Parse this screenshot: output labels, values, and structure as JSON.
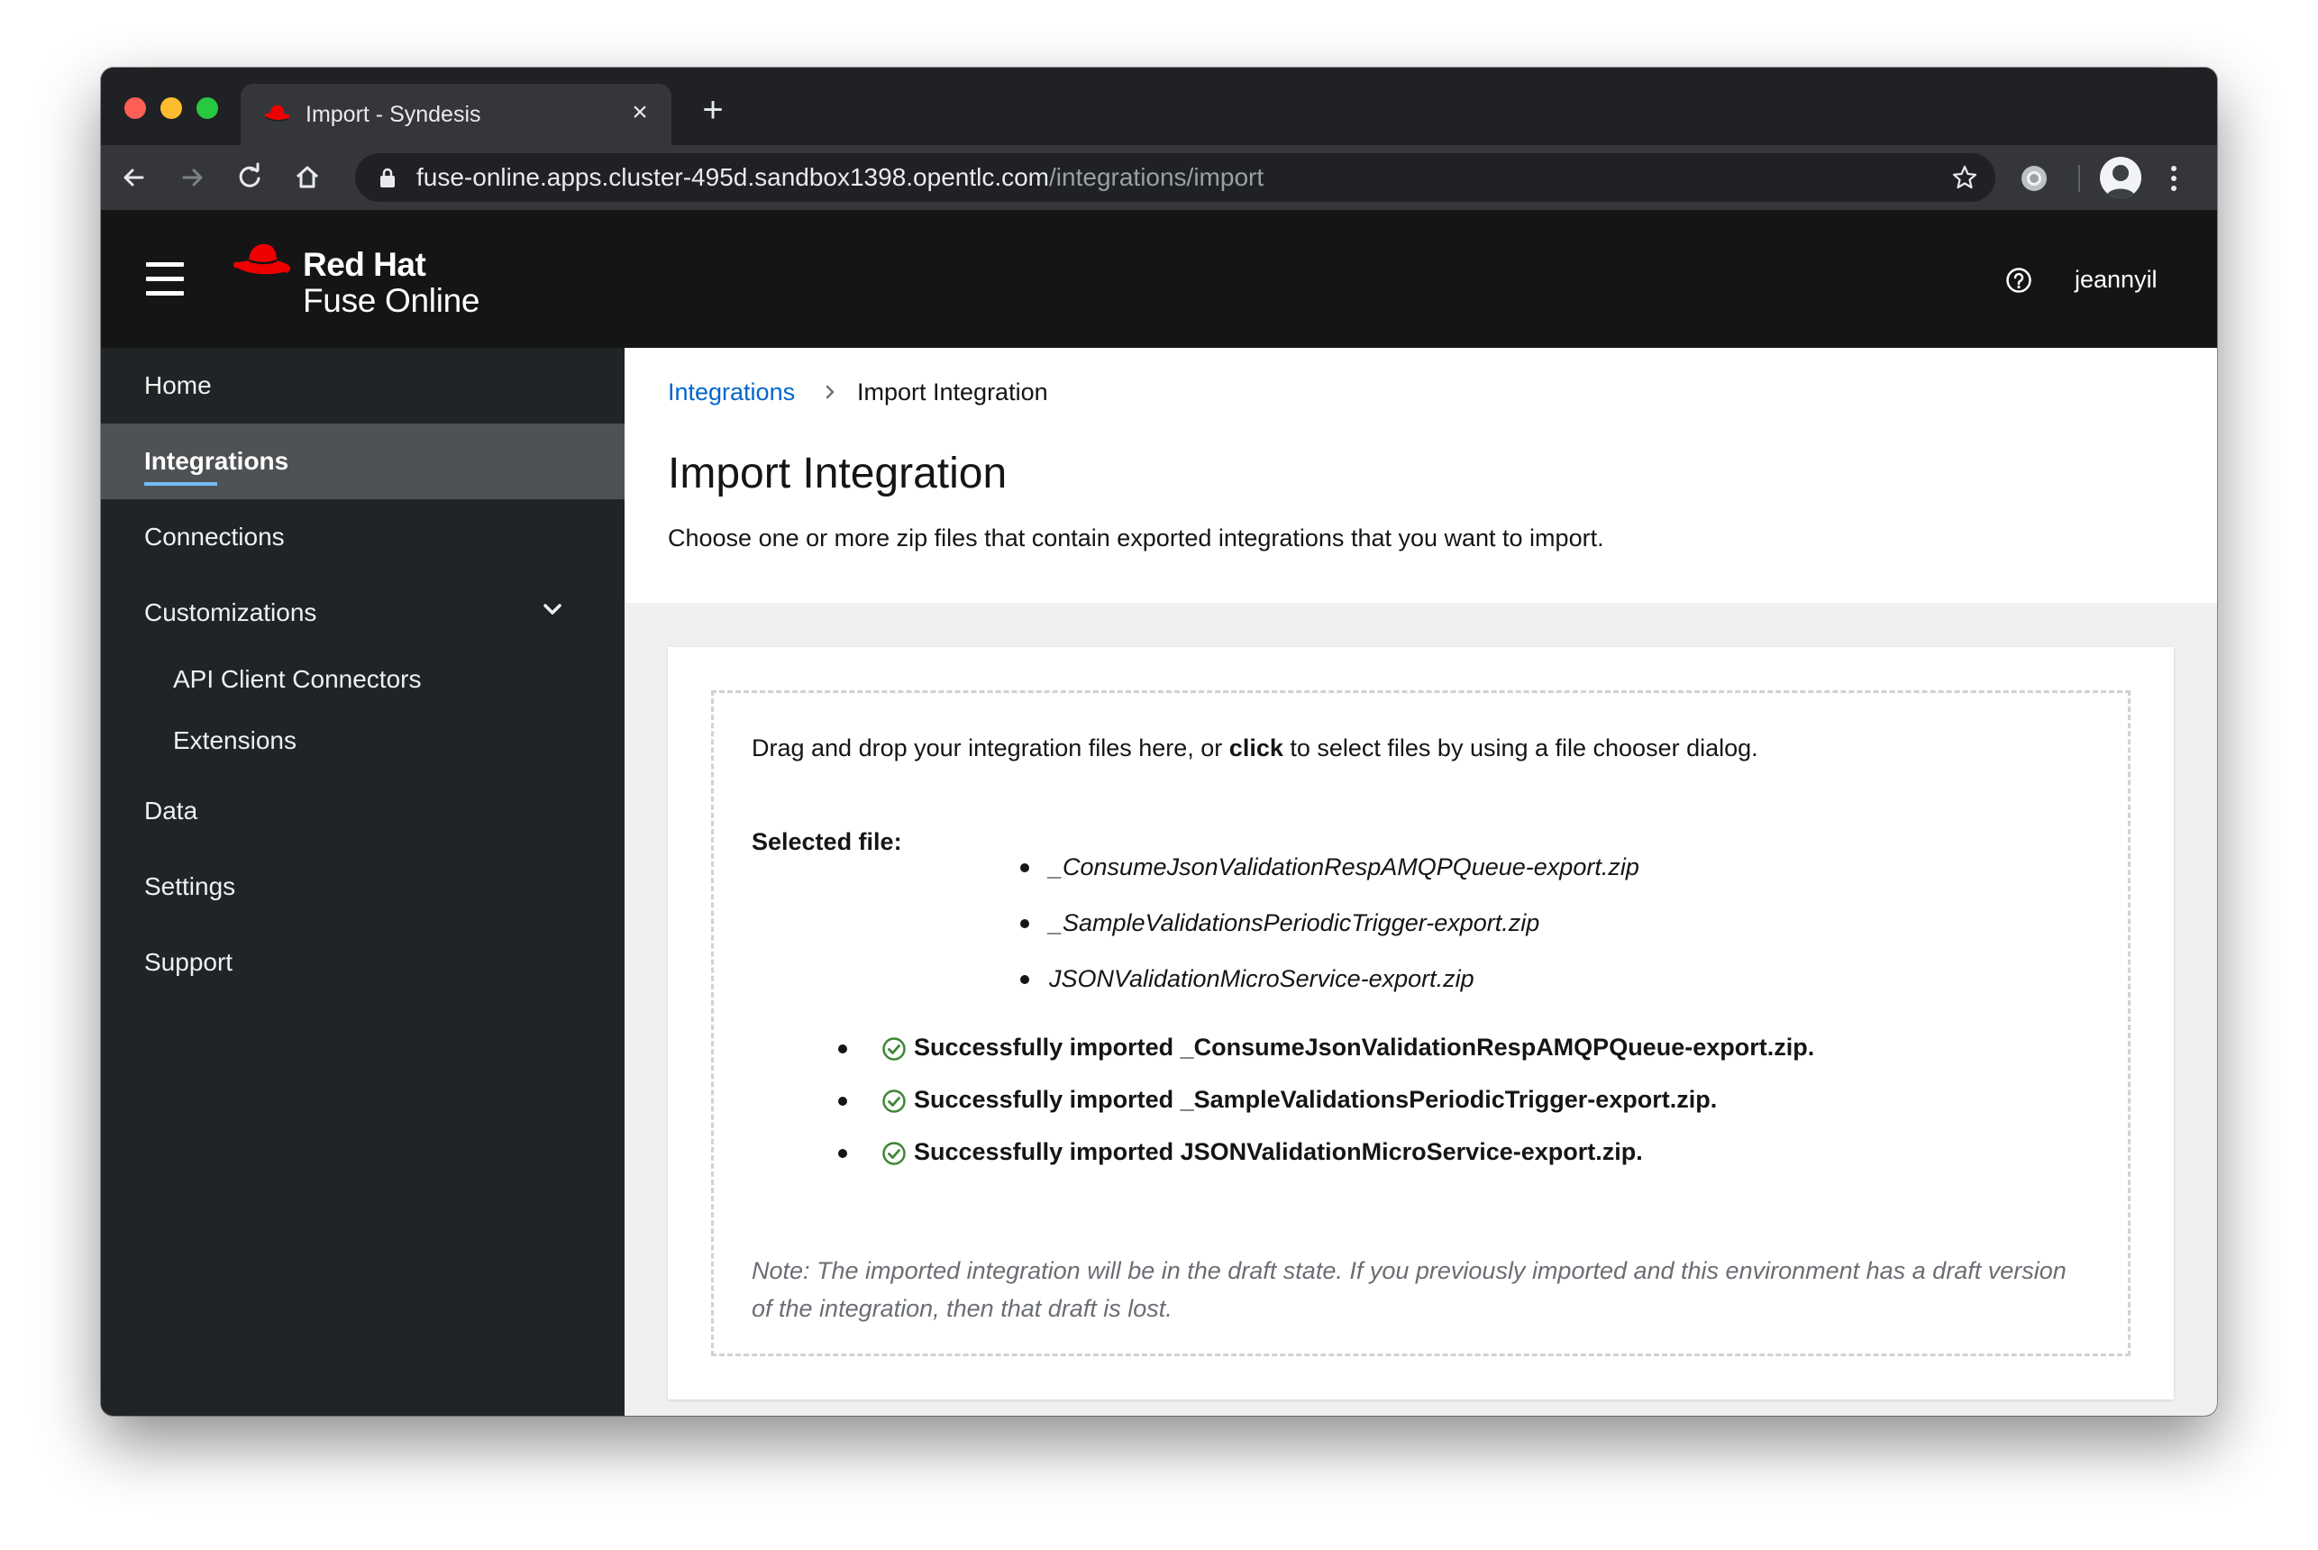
{
  "browser": {
    "tab_title": "Import - Syndesis",
    "url_host": "fuse-online.apps.cluster-495d.sandbox1398.opentlc.com",
    "url_path": "/integrations/import"
  },
  "masthead": {
    "brand_line1": "Red Hat",
    "brand_line2": "Fuse Online",
    "username": "jeannyil"
  },
  "sidebar": {
    "items": [
      {
        "label": "Home"
      },
      {
        "label": "Integrations",
        "active": true
      },
      {
        "label": "Connections"
      },
      {
        "label": "Customizations"
      },
      {
        "label": "API Client Connectors"
      },
      {
        "label": "Extensions"
      },
      {
        "label": "Data"
      },
      {
        "label": "Settings"
      },
      {
        "label": "Support"
      }
    ]
  },
  "breadcrumb": {
    "link": "Integrations",
    "current": "Import Integration"
  },
  "page": {
    "title": "Import Integration",
    "description": "Choose one or more zip files that contain exported integrations that you want to import."
  },
  "dropzone": {
    "instruction_before": "Drag and drop your integration files here, or ",
    "instruction_bold": "click",
    "instruction_after": " to select files by using a file chooser dialog.",
    "selected_label": "Selected file:",
    "selected_files": [
      "_ConsumeJsonValidationRespAMQPQueue-export.zip",
      "_SampleValidationsPeriodicTrigger-export.zip",
      "JSONValidationMicroService-export.zip"
    ],
    "results": [
      "Successfully imported _ConsumeJsonValidationRespAMQPQueue-export.zip.",
      "Successfully imported _SampleValidationsPeriodicTrigger-export.zip.",
      "Successfully imported JSONValidationMicroService-export.zip."
    ],
    "note": "Note: The imported integration will be in the draft state. If you previously imported and this environment has a draft version of the integration, then that draft is lost."
  },
  "colors": {
    "brand_red": "#ee0000",
    "link_blue": "#0066cc",
    "success_green": "#3e8635",
    "active_underline": "#73bcf7"
  }
}
